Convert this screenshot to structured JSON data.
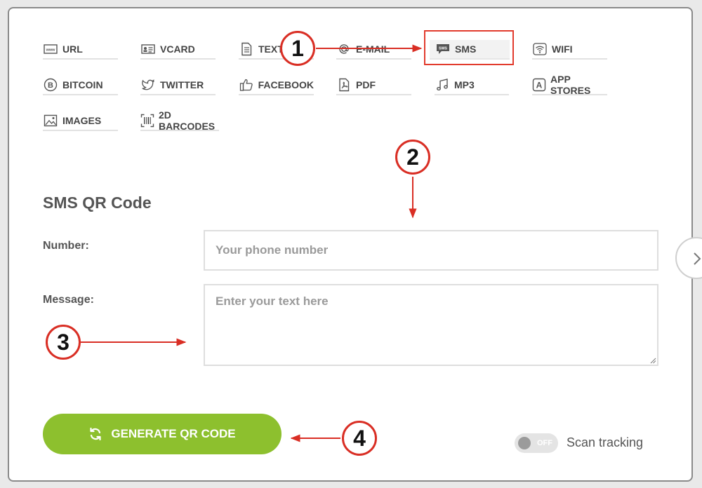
{
  "tabs": [
    {
      "label": "URL",
      "icon": "www-icon"
    },
    {
      "label": "VCARD",
      "icon": "vcard-icon"
    },
    {
      "label": "TEXT",
      "icon": "text-document-icon"
    },
    {
      "label": "E-MAIL",
      "icon": "at-sign-icon"
    },
    {
      "label": "SMS",
      "icon": "sms-bubble-icon",
      "active": true
    },
    {
      "label": "WIFI",
      "icon": "wifi-icon"
    },
    {
      "label": "BITCOIN",
      "icon": "bitcoin-icon"
    },
    {
      "label": "TWITTER",
      "icon": "twitter-bird-icon"
    },
    {
      "label": "FACEBOOK",
      "icon": "thumbs-up-icon"
    },
    {
      "label": "PDF",
      "icon": "pdf-icon"
    },
    {
      "label": "MP3",
      "icon": "music-note-icon"
    },
    {
      "label": "APP STORES",
      "icon": "app-store-icon"
    },
    {
      "label": "IMAGES",
      "icon": "image-icon"
    },
    {
      "label": "2D BARCODES",
      "icon": "barcode-icon"
    }
  ],
  "sms_icon_text": "SMS",
  "form": {
    "title": "SMS QR Code",
    "number_label": "Number:",
    "number_placeholder": "Your phone number",
    "number_value": "",
    "message_label": "Message:",
    "message_placeholder": "Enter your text here",
    "message_value": ""
  },
  "generate_button": "GENERATE QR CODE",
  "scan_tracking": {
    "label": "Scan tracking",
    "state": "OFF"
  },
  "annotations": [
    "1",
    "2",
    "3",
    "4"
  ],
  "colors": {
    "accent_green": "#8dc02e",
    "annotation_red": "#d92e24"
  }
}
